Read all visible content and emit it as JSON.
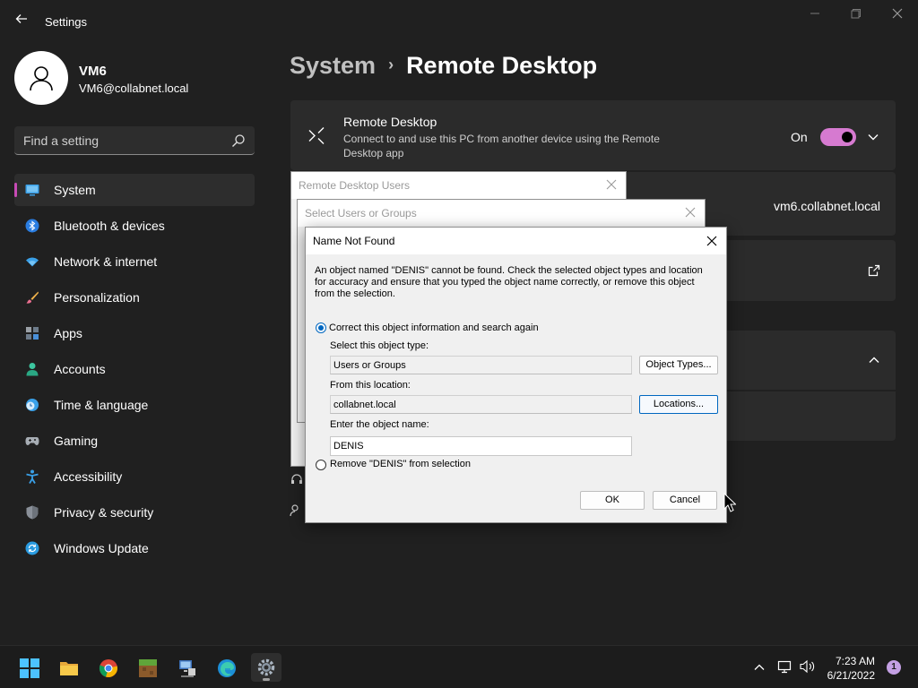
{
  "window": {
    "title": "Settings",
    "accent_color": "#c74ab5",
    "icons": [
      "back-arrow-icon",
      "minimize-icon",
      "maximize-icon",
      "close-icon"
    ]
  },
  "profile": {
    "name": "VM6",
    "email": "VM6@collabnet.local",
    "icon": "user-icon"
  },
  "search": {
    "placeholder": "Find a setting",
    "icon": "search-icon"
  },
  "sidebar": {
    "items": [
      {
        "label": "System",
        "icon": "system-icon",
        "active": true
      },
      {
        "label": "Bluetooth & devices",
        "icon": "bluetooth-icon"
      },
      {
        "label": "Network & internet",
        "icon": "wifi-icon"
      },
      {
        "label": "Personalization",
        "icon": "brush-icon"
      },
      {
        "label": "Apps",
        "icon": "apps-icon"
      },
      {
        "label": "Accounts",
        "icon": "accounts-icon"
      },
      {
        "label": "Time & language",
        "icon": "clock-globe-icon"
      },
      {
        "label": "Gaming",
        "icon": "gamepad-icon"
      },
      {
        "label": "Accessibility",
        "icon": "accessibility-icon"
      },
      {
        "label": "Privacy & security",
        "icon": "shield-icon"
      },
      {
        "label": "Windows Update",
        "icon": "update-icon"
      }
    ]
  },
  "header": {
    "parent": "System",
    "separator": "›",
    "current": "Remote Desktop"
  },
  "remote_desktop_card": {
    "title": "Remote Desktop",
    "description": "Connect to and use this PC from another device using the Remote Desktop app",
    "toggle_label": "On",
    "toggle_on": true,
    "icon": "remote-desktop-icon"
  },
  "pc_name_card": {
    "value": "vm6.collabnet.local"
  },
  "dialogs": {
    "remote_desktop_users": {
      "title": "Remote Desktop Users"
    },
    "select_users": {
      "title": "Select Users or Groups"
    },
    "name_not_found": {
      "title": "Name Not Found",
      "message": "An object named \"DENIS\" cannot be found. Check the selected object types and location for accuracy and ensure that you typed the object name correctly, or remove this object from the selection.",
      "option_correct": "Correct this object information and search again",
      "object_type_label": "Select this object type:",
      "object_type_value": "Users or Groups",
      "object_types_button": "Object Types...",
      "location_label": "From this location:",
      "location_value": "collabnet.local",
      "locations_button": "Locations...",
      "object_name_label": "Enter the object name:",
      "object_name_value": "DENIS",
      "option_remove": "Remove \"DENIS\" from selection",
      "ok_button": "OK",
      "cancel_button": "Cancel",
      "selected_option": "correct"
    }
  },
  "taskbar": {
    "apps": [
      "start-icon",
      "file-explorer-icon",
      "chrome-icon",
      "minecraft-icon",
      "network-computer-icon",
      "edge-icon",
      "settings-icon"
    ],
    "time": "7:23 AM",
    "date": "6/21/2022",
    "notification_count": "1",
    "tray_icons": [
      "chevron-up-icon",
      "network-icon",
      "volume-icon"
    ]
  }
}
